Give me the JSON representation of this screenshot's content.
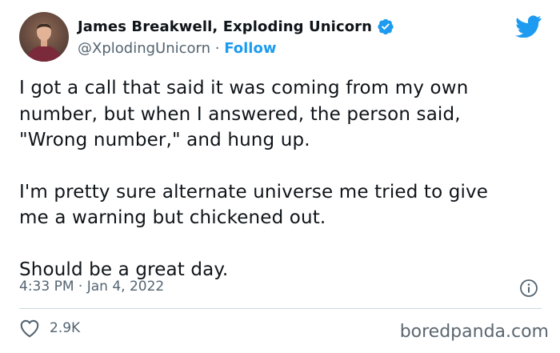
{
  "tweet": {
    "author": {
      "display_name": "James Breakwell, Exploding Unicorn",
      "handle": "@XplodingUnicorn",
      "separator": " · ",
      "follow_label": "Follow",
      "verified": true
    },
    "text": {
      "paragraph_1": [
        "I got a call that said it was coming from my own",
        "number, but when I answered, the person said,",
        "\"Wrong number,\" and hung up."
      ],
      "paragraph_2": [
        "I'm pretty sure alternate universe me tried to give",
        "me a warning but chickened out."
      ],
      "paragraph_3": [
        "Should be a great day."
      ]
    },
    "timestamp": "4:33 PM · Jan 4, 2022",
    "likes": "2.9K"
  },
  "watermark": "boredpanda.com",
  "icons": {
    "brand": "twitter-bird-icon",
    "verified": "verified-badge-icon",
    "info": "info-icon",
    "like": "heart-icon"
  },
  "colors": {
    "accent": "#1d9bf0",
    "text_primary": "#0f1419",
    "text_secondary": "#536471",
    "divider": "#cfd9de"
  }
}
